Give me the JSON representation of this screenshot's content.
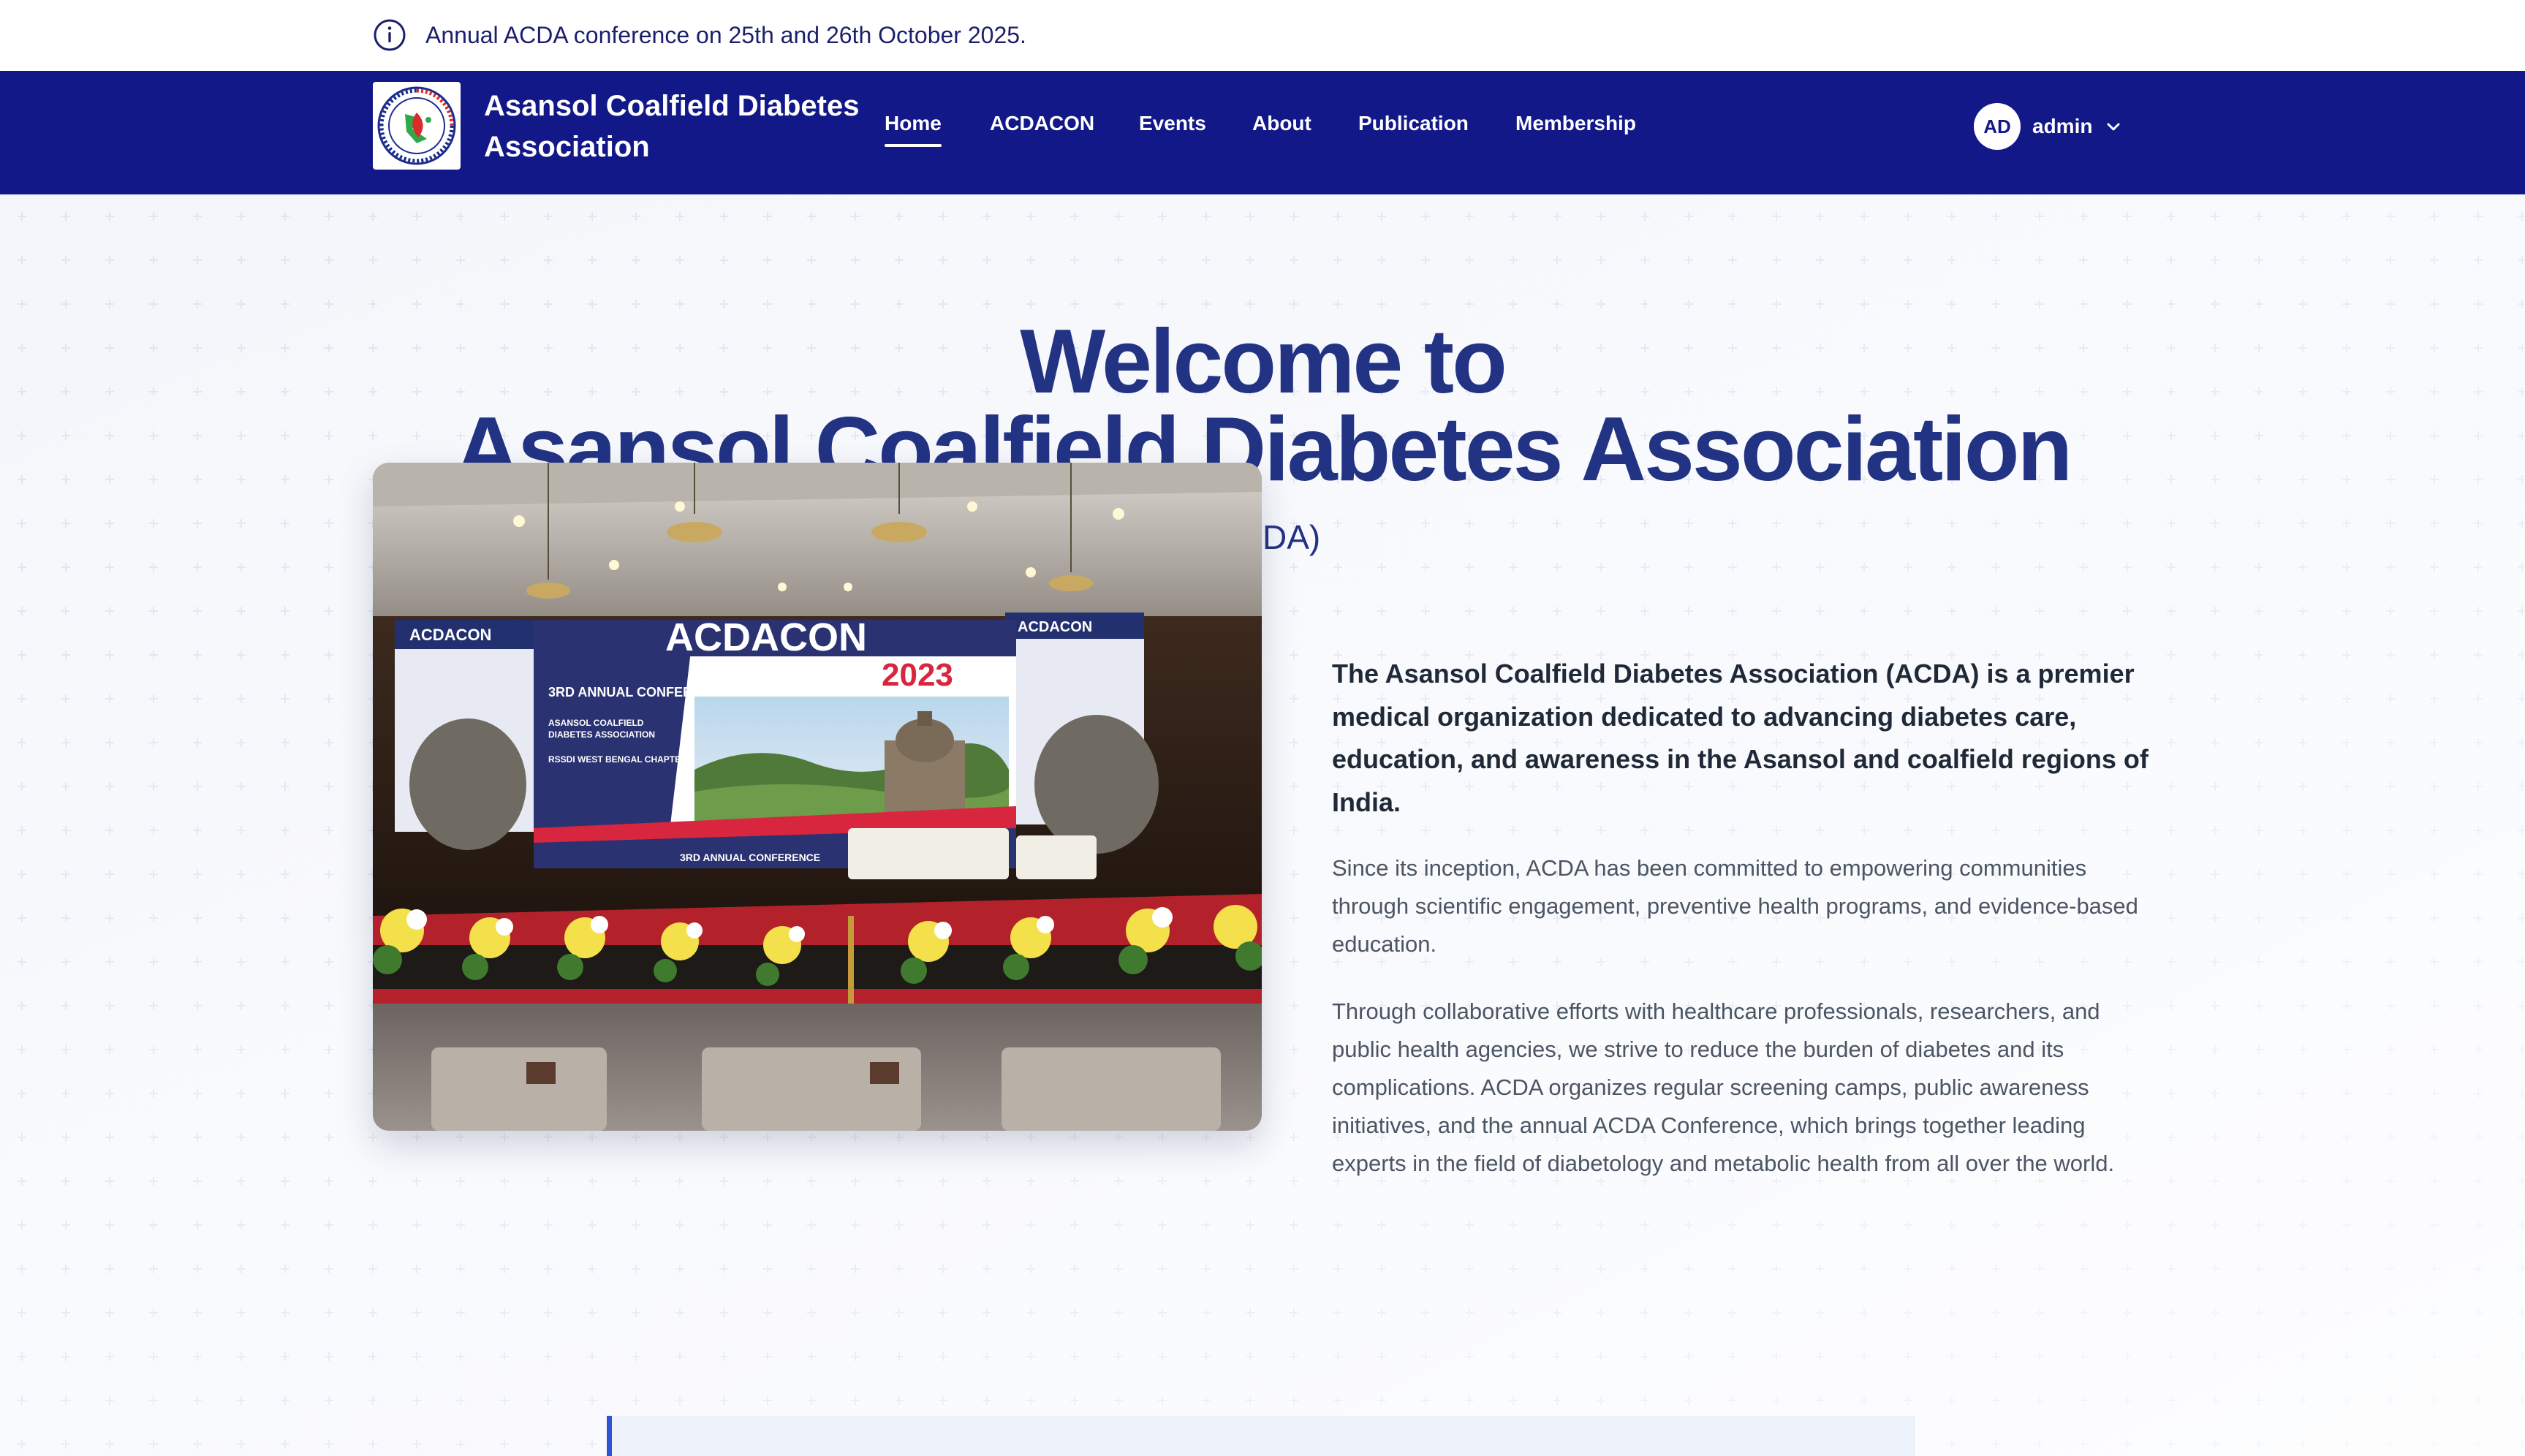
{
  "announcement": {
    "icon": "info-circle-icon",
    "text": "Annual ACDA conference on 25th and 26th October 2025."
  },
  "header": {
    "logo_alt": "ACDA logo",
    "brand_line1": "Asansol Coalfield Diabetes",
    "brand_line2": "Association",
    "nav": [
      {
        "label": "Home",
        "active": true
      },
      {
        "label": "ACDACON",
        "active": false
      },
      {
        "label": "Events",
        "active": false
      },
      {
        "label": "About",
        "active": false
      },
      {
        "label": "Publication",
        "active": false
      },
      {
        "label": "Membership",
        "active": false
      }
    ],
    "user": {
      "initials": "AD",
      "name": "admin",
      "menu_icon": "chevron-down-icon"
    }
  },
  "hero": {
    "title_line1": "Welcome to",
    "title_line2": "Asansol Coalfield Diabetes Association",
    "subtitle": "(ACDA)",
    "image": {
      "banner_title": "ACDACON",
      "banner_year": "2023",
      "banner_subtitle": "3RD ANNUAL CONFERENCE",
      "banner_org": "ASANSOL COALFIELD DIABETES ASSOCIATION",
      "banner_chapter": "RSSDI WEST BENGAL CHAPTER"
    },
    "lead": "The Asansol Coalfield Diabetes Association (ACDA) is a premier medical organization dedicated to advancing diabetes care, education, and awareness in the Asansol and coalfield regions of India.",
    "paragraph1": "Since its inception, ACDA has been committed to empowering communities through scientific engagement, preventive health programs, and evidence-based education.",
    "paragraph2": "Through collaborative efforts with healthcare professionals, researchers, and public health agencies, we strive to reduce the burden of diabetes and its complications. ACDA organizes regular screening camps, public awareness initiatives, and the annual ACDA Conference, which brings together leading experts in the field of diabetology and metabolic health from all over the world."
  },
  "colors": {
    "nav_bg": "#121887",
    "title": "#233384",
    "accent": "#2f55d4",
    "hero_bg": "#f5f7fb"
  }
}
